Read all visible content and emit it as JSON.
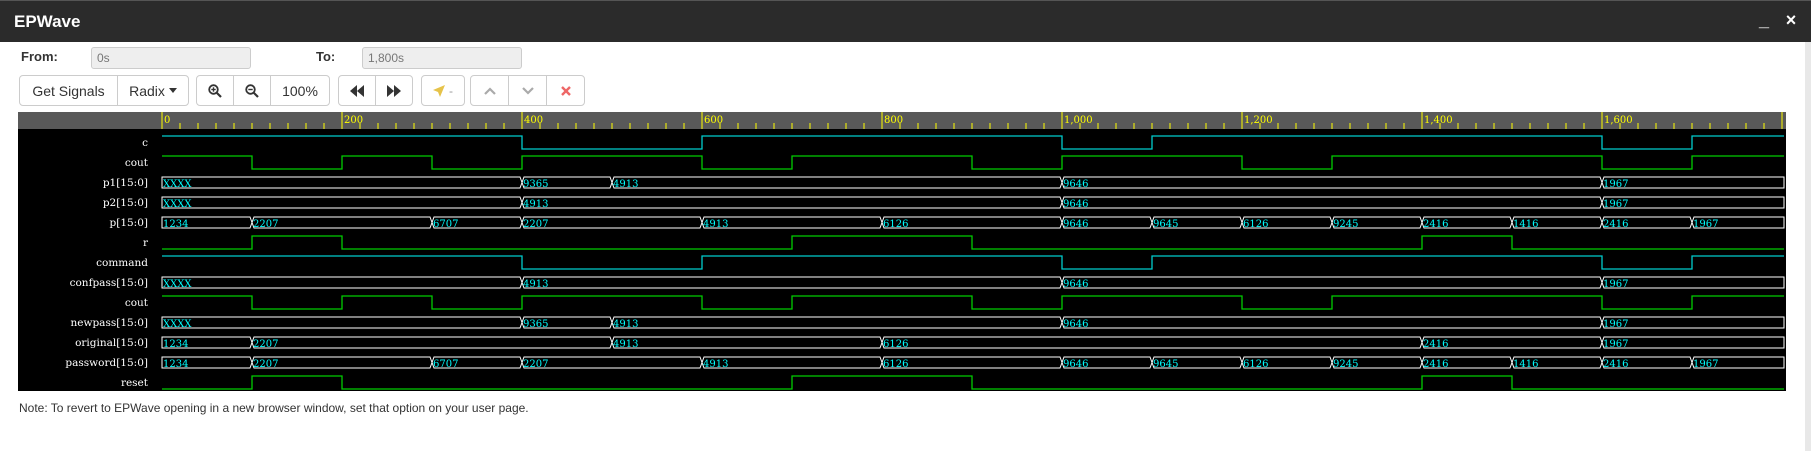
{
  "window": {
    "title": "EPWave",
    "minimize_glyph": "_",
    "close_glyph": "×"
  },
  "range": {
    "from_label": "From:",
    "from_value": "0s",
    "to_label": "To:",
    "to_value": "1,800s"
  },
  "toolbar": {
    "get_signals": "Get Signals",
    "radix": "Radix",
    "zoom_level": "100%",
    "icons": [
      "zoom-in-icon",
      "zoom-out-icon",
      "first-edge-icon",
      "last-edge-icon",
      "cursor-icon",
      "chevron-up-icon",
      "chevron-down-icon",
      "delete-icon"
    ],
    "marker_dash": "-"
  },
  "note": "Note: To revert to EPWave opening in a new browser window, set that option on your user page.",
  "colors": {
    "clock_high": "#00cc00",
    "wire": "#00cccc",
    "value_text": "#00ffff",
    "ruler_bg": "#595959",
    "ruler_text": "#ffff00"
  },
  "timeline": {
    "start": 0,
    "end": 1800,
    "ticks": [
      {
        "t": 0,
        "label": "0"
      },
      {
        "t": 200,
        "label": "200"
      },
      {
        "t": 400,
        "label": "400"
      },
      {
        "t": 600,
        "label": "600"
      },
      {
        "t": 800,
        "label": "800"
      },
      {
        "t": 1000,
        "label": "1,000"
      },
      {
        "t": 1200,
        "label": "1,200"
      },
      {
        "t": 1400,
        "label": "1,400"
      },
      {
        "t": 1600,
        "label": "1,600"
      }
    ]
  },
  "signals": [
    {
      "name": "c",
      "kind": "bit",
      "color": "#00cccc",
      "initial": 1,
      "toggles": [
        400,
        600,
        1000,
        1100,
        1600,
        1700
      ]
    },
    {
      "name": "cout",
      "kind": "bit",
      "color": "#00cc00",
      "initial": 1,
      "toggles": [
        100,
        200,
        300,
        400,
        600,
        700,
        900,
        1000,
        1200,
        1300,
        1600,
        1700
      ]
    },
    {
      "name": "p1[15:0]",
      "kind": "bus",
      "segments": [
        {
          "t": 0,
          "v": "XXXX"
        },
        {
          "t": 400,
          "v": "9365"
        },
        {
          "t": 500,
          "v": "4913"
        },
        {
          "t": 1000,
          "v": "9646"
        },
        {
          "t": 1600,
          "v": "1967"
        }
      ]
    },
    {
      "name": "p2[15:0]",
      "kind": "bus",
      "segments": [
        {
          "t": 0,
          "v": "XXXX"
        },
        {
          "t": 400,
          "v": "4913"
        },
        {
          "t": 1000,
          "v": "9646"
        },
        {
          "t": 1600,
          "v": "1967"
        }
      ]
    },
    {
      "name": "p[15:0]",
      "kind": "bus",
      "segments": [
        {
          "t": 0,
          "v": "1234"
        },
        {
          "t": 100,
          "v": "2207"
        },
        {
          "t": 300,
          "v": "6707"
        },
        {
          "t": 400,
          "v": "2207"
        },
        {
          "t": 600,
          "v": "4913"
        },
        {
          "t": 800,
          "v": "6126"
        },
        {
          "t": 1000,
          "v": "9646"
        },
        {
          "t": 1100,
          "v": "9645"
        },
        {
          "t": 1200,
          "v": "6126"
        },
        {
          "t": 1300,
          "v": "9245"
        },
        {
          "t": 1400,
          "v": "2416"
        },
        {
          "t": 1500,
          "v": "1416"
        },
        {
          "t": 1600,
          "v": "2416"
        },
        {
          "t": 1700,
          "v": "1967"
        }
      ]
    },
    {
      "name": "r",
      "kind": "bit",
      "color": "#00cc00",
      "initial": 0,
      "toggles": [
        100,
        200,
        700,
        900,
        1400,
        1500
      ]
    },
    {
      "name": "command",
      "kind": "bit",
      "color": "#00cccc",
      "initial": 1,
      "toggles": [
        400,
        600,
        1000,
        1100,
        1600,
        1700
      ]
    },
    {
      "name": "confpass[15:0]",
      "kind": "bus",
      "segments": [
        {
          "t": 0,
          "v": "XXXX"
        },
        {
          "t": 400,
          "v": "4913"
        },
        {
          "t": 1000,
          "v": "9646"
        },
        {
          "t": 1600,
          "v": "1967"
        }
      ]
    },
    {
      "name": "cout",
      "kind": "bit",
      "color": "#00cc00",
      "initial": 1,
      "toggles": [
        100,
        200,
        300,
        400,
        600,
        700,
        900,
        1000,
        1200,
        1300,
        1600,
        1700
      ]
    },
    {
      "name": "newpass[15:0]",
      "kind": "bus",
      "segments": [
        {
          "t": 0,
          "v": "XXXX"
        },
        {
          "t": 400,
          "v": "9365"
        },
        {
          "t": 500,
          "v": "4913"
        },
        {
          "t": 1000,
          "v": "9646"
        },
        {
          "t": 1600,
          "v": "1967"
        }
      ]
    },
    {
      "name": "original[15:0]",
      "kind": "bus",
      "segments": [
        {
          "t": 0,
          "v": "1234"
        },
        {
          "t": 100,
          "v": "2207"
        },
        {
          "t": 500,
          "v": "4913"
        },
        {
          "t": 800,
          "v": "6126"
        },
        {
          "t": 1400,
          "v": "2416"
        },
        {
          "t": 1600,
          "v": "1967"
        }
      ]
    },
    {
      "name": "password[15:0]",
      "kind": "bus",
      "segments": [
        {
          "t": 0,
          "v": "1234"
        },
        {
          "t": 100,
          "v": "2207"
        },
        {
          "t": 300,
          "v": "6707"
        },
        {
          "t": 400,
          "v": "2207"
        },
        {
          "t": 600,
          "v": "4913"
        },
        {
          "t": 800,
          "v": "6126"
        },
        {
          "t": 1000,
          "v": "9646"
        },
        {
          "t": 1100,
          "v": "9645"
        },
        {
          "t": 1200,
          "v": "6126"
        },
        {
          "t": 1300,
          "v": "9245"
        },
        {
          "t": 1400,
          "v": "2416"
        },
        {
          "t": 1500,
          "v": "1416"
        },
        {
          "t": 1600,
          "v": "2416"
        },
        {
          "t": 1700,
          "v": "1967"
        }
      ]
    },
    {
      "name": "reset",
      "kind": "bit",
      "color": "#00cc00",
      "initial": 0,
      "toggles": [
        100,
        200,
        700,
        900,
        1400,
        1500
      ]
    }
  ]
}
